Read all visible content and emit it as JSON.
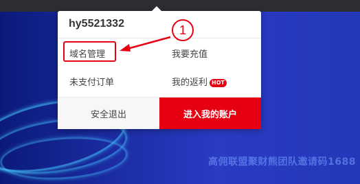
{
  "popup": {
    "username": "hy5521332",
    "menu": [
      {
        "label": "域名管理"
      },
      {
        "label": "我要充值"
      },
      {
        "label": "未支付订单"
      },
      {
        "label": "我的返利",
        "badge": "HOT"
      }
    ],
    "logout_label": "安全退出",
    "account_label": "进入我的账户"
  },
  "annotation": {
    "step_number": "1"
  },
  "background": {
    "watermark": "高佣联盟聚财熊团队邀请码1688"
  },
  "colors": {
    "accent": "#e60012",
    "background": "#1d2ea8",
    "topbar": "#2d2d34"
  }
}
